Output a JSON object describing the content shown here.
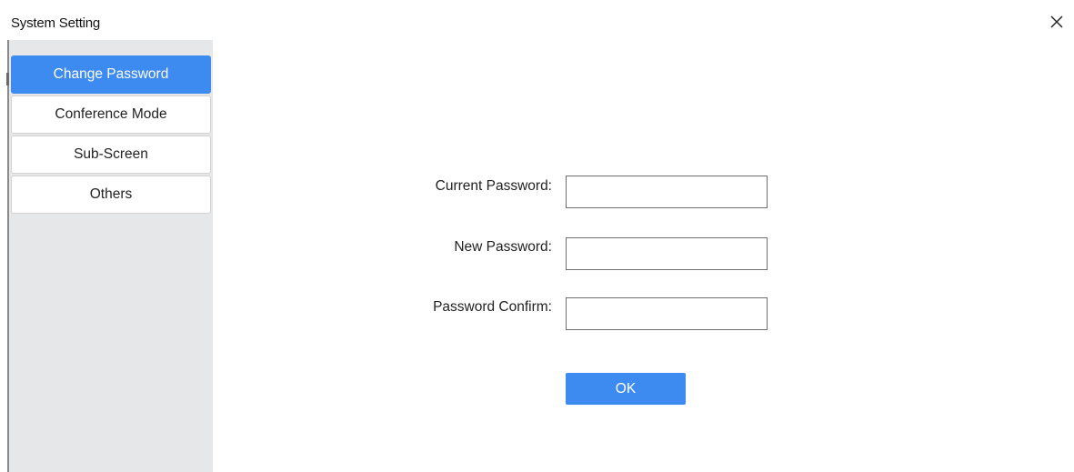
{
  "window": {
    "title": "System Setting",
    "close_icon": "close-icon"
  },
  "sidebar": {
    "items": [
      {
        "label": "Change Password",
        "active": true
      },
      {
        "label": "Conference Mode",
        "active": false
      },
      {
        "label": "Sub-Screen",
        "active": false
      },
      {
        "label": "Others",
        "active": false
      }
    ]
  },
  "form": {
    "current_password": {
      "label": "Current Password:",
      "value": ""
    },
    "new_password": {
      "label": "New Password:",
      "value": ""
    },
    "confirm_password": {
      "label": "Password Confirm:",
      "value": ""
    },
    "ok_label": "OK"
  },
  "colors": {
    "accent": "#3d8bf0",
    "sidebar_bg": "#e6e7e9"
  }
}
